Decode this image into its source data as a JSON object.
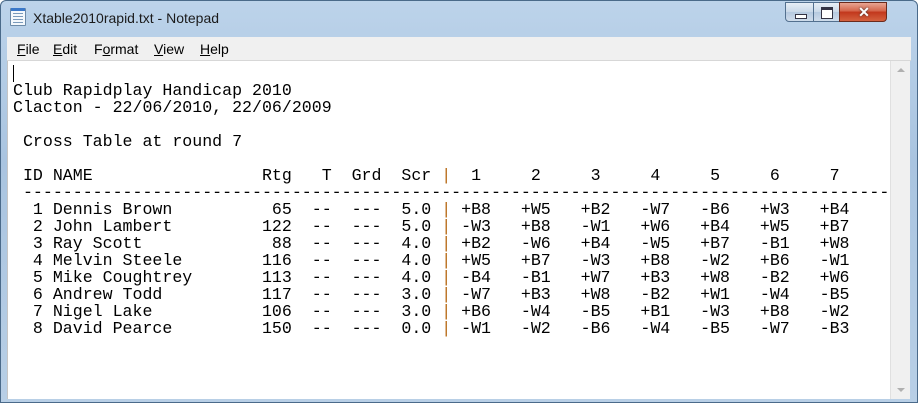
{
  "window": {
    "title": "Xtable2010rapid.txt - Notepad",
    "icon": "notepad-icon",
    "controls": {
      "minimize": "minimize-icon",
      "maximize": "maximize-icon",
      "close": "close-icon"
    }
  },
  "menu": [
    {
      "label": "File",
      "accel": "F",
      "rest": "ile"
    },
    {
      "label": "Edit",
      "accel": "E",
      "rest": "dit"
    },
    {
      "label": "Format",
      "accel": "o",
      "pre": "F",
      "rest": "rmat"
    },
    {
      "label": "View",
      "accel": "V",
      "rest": "iew"
    },
    {
      "label": "Help",
      "accel": "H",
      "rest": "elp"
    }
  ],
  "document": {
    "blank": "",
    "heading1": "Club Rapidplay Handicap 2010",
    "heading2": "Clacton - 22/06/2010, 22/06/2009",
    "round_label": " Cross Table at round 7",
    "header_left": " ID NAME                 Rtg   T  Grd  Scr ",
    "sep_char": "|",
    "header_right": "  1     2     3     4     5     6     7",
    "rule": " ---------------------------------------------------------------------------------------",
    "rows": [
      {
        "left": "  1 Dennis Brown          65  --  ---  5.0 ",
        "right": " +B8   +W5   +B2   -W7   -B6   +W3   +B4"
      },
      {
        "left": "  2 John Lambert         122  --  ---  5.0 ",
        "right": " -W3   +B8   -W1   +W6   +B4   +W5   +B7"
      },
      {
        "left": "  3 Ray Scott             88  --  ---  4.0 ",
        "right": " +B2   -W6   +B4   -W5   +B7   -B1   +W8"
      },
      {
        "left": "  4 Melvin Steele        116  --  ---  4.0 ",
        "right": " +W5   +B7   -W3   +B8   -W2   +B6   -W1"
      },
      {
        "left": "  5 Mike Coughtrey       113  --  ---  4.0 ",
        "right": " -B4   -B1   +W7   +B3   +W8   -B2   +W6"
      },
      {
        "left": "  6 Andrew Todd          117  --  ---  3.0 ",
        "right": " -W7   +B3   +W8   -B2   +W1   -W4   -B5"
      },
      {
        "left": "  7 Nigel Lake           106  --  ---  3.0 ",
        "right": " +B6   -W4   -B5   +B1   -W3   +B8   -W2"
      },
      {
        "left": "  8 David Pearce         150  --  ---  0.0 ",
        "right": " -W1   -W2   -B6   -W4   -B5   -W7   -B3"
      }
    ]
  },
  "colors": {
    "titlebar": "#b5cde6",
    "close": "#c2371c",
    "separator": "#b86a16"
  }
}
